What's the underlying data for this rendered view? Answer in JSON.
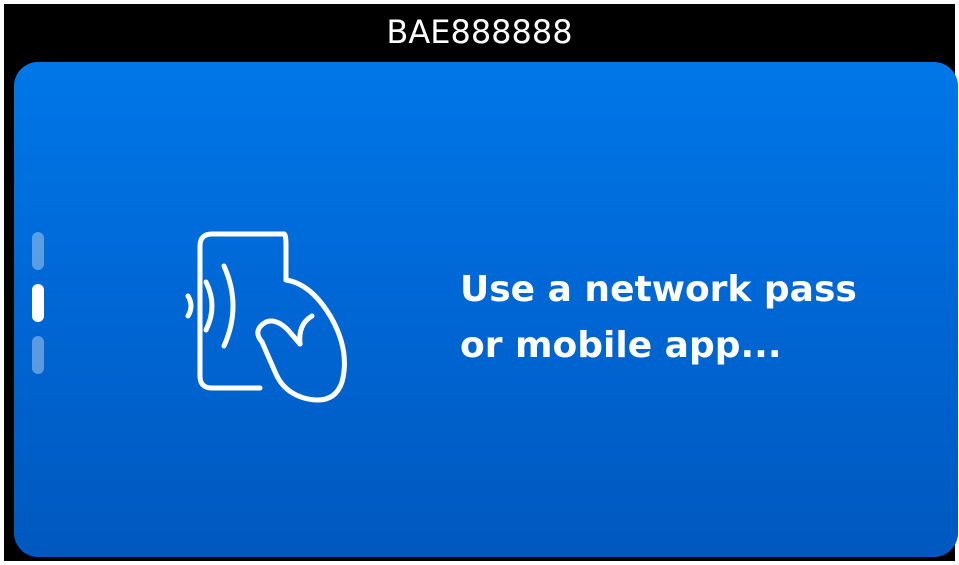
{
  "header": {
    "station_id": "BAE888888"
  },
  "pager": {
    "total": 3,
    "active_index": 1
  },
  "main": {
    "icon": "phone-tap-hand-icon",
    "message_line_1": "Use a network pass",
    "message_line_2": "or mobile app..."
  },
  "colors": {
    "background": "#000000",
    "panel_top": "#0077e8",
    "panel_bottom": "#0058bf",
    "text": "#ffffff"
  }
}
